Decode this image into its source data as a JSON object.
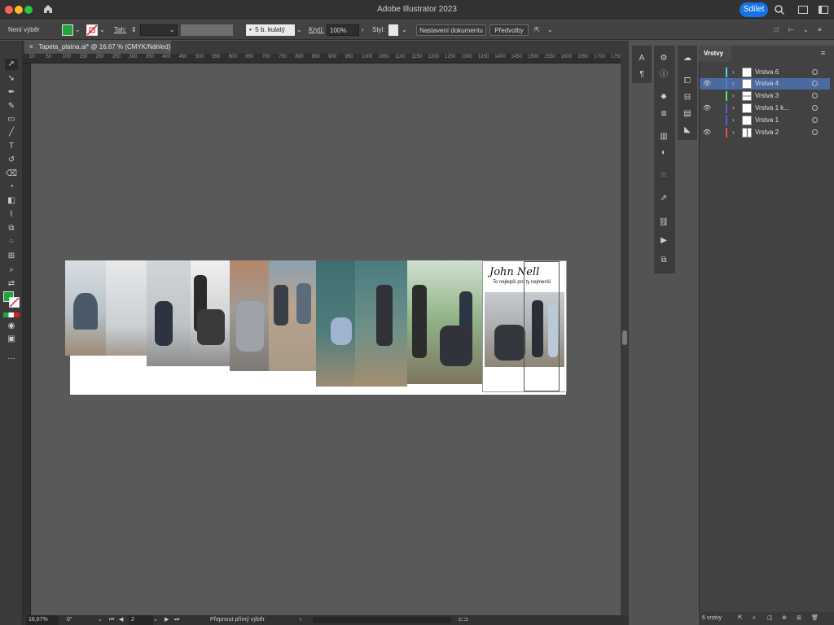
{
  "app": {
    "title": "Adobe Illustrator 2023",
    "share_label": "Sdílet"
  },
  "controlbar": {
    "selection_label": "Není výběr",
    "stroke_label": "Tah:",
    "brush_label": "5 b. kulatý",
    "opacity_label": "Krytí:",
    "opacity_value": "100%",
    "style_label": "Styl:",
    "document_setup_label": "Nastavení dokumentu",
    "preferences_label": "Předvolby"
  },
  "tab": {
    "title": "Tapeta_platna.ai* @ 16,67 % (CMYK/Náhled)",
    "close": "×"
  },
  "ruler_marks": [
    "10",
    "50",
    "100",
    "150",
    "200",
    "250",
    "300",
    "350",
    "400",
    "450",
    "500",
    "550",
    "600",
    "650",
    "700",
    "750",
    "800",
    "850",
    "900",
    "950",
    "1000",
    "1050",
    "1100",
    "1150",
    "1200",
    "1250",
    "1300",
    "1350",
    "1400",
    "1450",
    "1500",
    "1550",
    "1600",
    "1650",
    "1700",
    "1750"
  ],
  "artwork": {
    "brand": "John Nell",
    "tagline": "To nejlepší pro ty nejmenší"
  },
  "layers_panel": {
    "tab_label": "Vrstvy",
    "layers": [
      {
        "name": "Vrstva 6",
        "color": "#4fd1e6",
        "visible": false,
        "selected": false
      },
      {
        "name": "Vrstva 4",
        "color": "#4f7be6",
        "visible": true,
        "selected": true
      },
      {
        "name": "Vrstva 3",
        "color": "#4fe67a",
        "visible": false,
        "selected": false
      },
      {
        "name": "Vrstva 1 k...",
        "color": "#4f5ce6",
        "visible": true,
        "selected": false
      },
      {
        "name": "Vrstva 1",
        "color": "#4f5ce6",
        "visible": false,
        "selected": false
      },
      {
        "name": "Vrstva 2",
        "color": "#e64f4f",
        "visible": true,
        "selected": false
      }
    ],
    "count_label": "6 vrstvy"
  },
  "statusbar": {
    "zoom": "16,67%",
    "rotation": "0°",
    "artboard_number": "2",
    "mode_label": "Přepnout přímý výběr"
  },
  "colors": {
    "fill": "#1fa73a",
    "accent": "#1473e6",
    "selected_layer": "#4b6aa0"
  }
}
